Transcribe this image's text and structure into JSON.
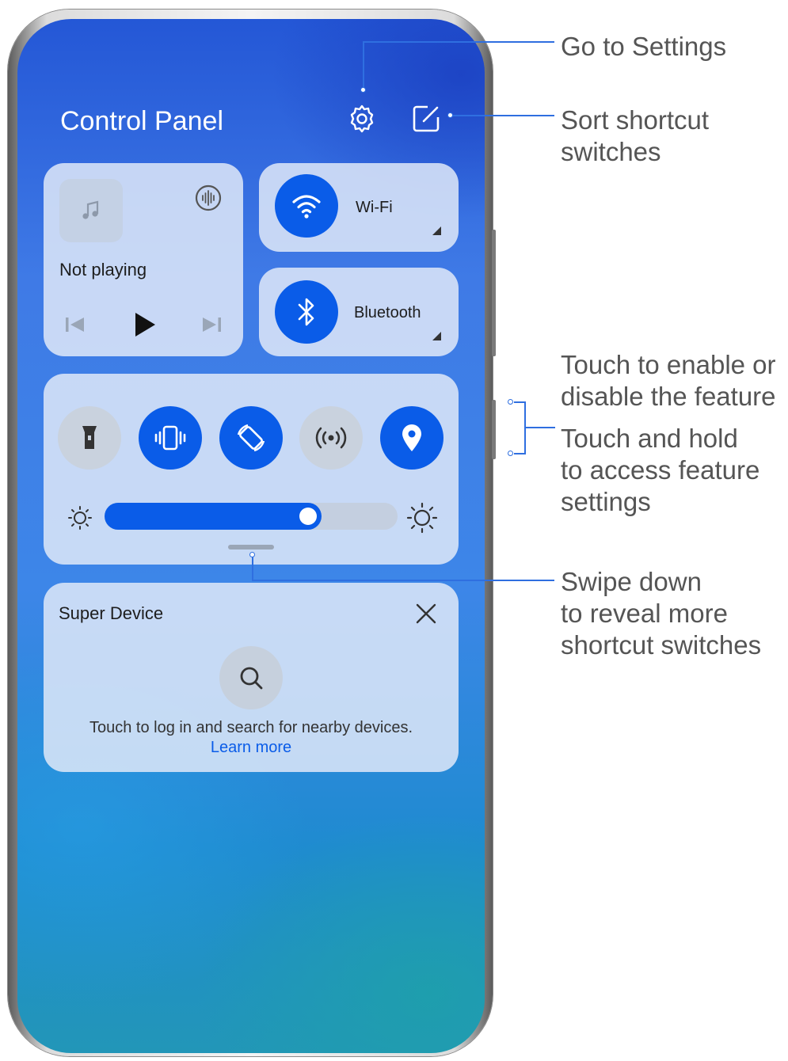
{
  "panel": {
    "title": "Control Panel",
    "header_icons": [
      "gear-icon",
      "edit-square-icon"
    ]
  },
  "media": {
    "status": "Not playing",
    "icons": [
      "music-note-icon",
      "audio-wave-icon",
      "previous-icon",
      "play-icon",
      "next-icon"
    ]
  },
  "wifi": {
    "label": "Wi-Fi",
    "on": true
  },
  "bluetooth": {
    "label": "Bluetooth",
    "on": true
  },
  "switches": [
    {
      "name": "flashlight",
      "on": false
    },
    {
      "name": "vibration",
      "on": true
    },
    {
      "name": "auto-rotate",
      "on": true
    },
    {
      "name": "hotspot",
      "on": false
    },
    {
      "name": "location",
      "on": true
    }
  ],
  "brightness": {
    "level": 0.74
  },
  "super_device": {
    "title": "Super Device",
    "description": "Touch to log in and search for nearby devices.",
    "link": "Learn more"
  },
  "annotations": {
    "go_to_settings": "Go to Settings",
    "sort_line1": "Sort shortcut",
    "sort_line2": "switches",
    "enable_line1": "Touch to enable or",
    "enable_line2": "disable the feature",
    "hold_line1": "Touch and hold",
    "hold_line2": "to access feature",
    "hold_line3": "settings",
    "swipe_line1": "Swipe down",
    "swipe_line2": "to reveal more",
    "swipe_line3": "shortcut switches"
  },
  "colors": {
    "accent": "#0a5ce8",
    "callout": "#2f6fe0",
    "annotation_text": "#555555"
  }
}
